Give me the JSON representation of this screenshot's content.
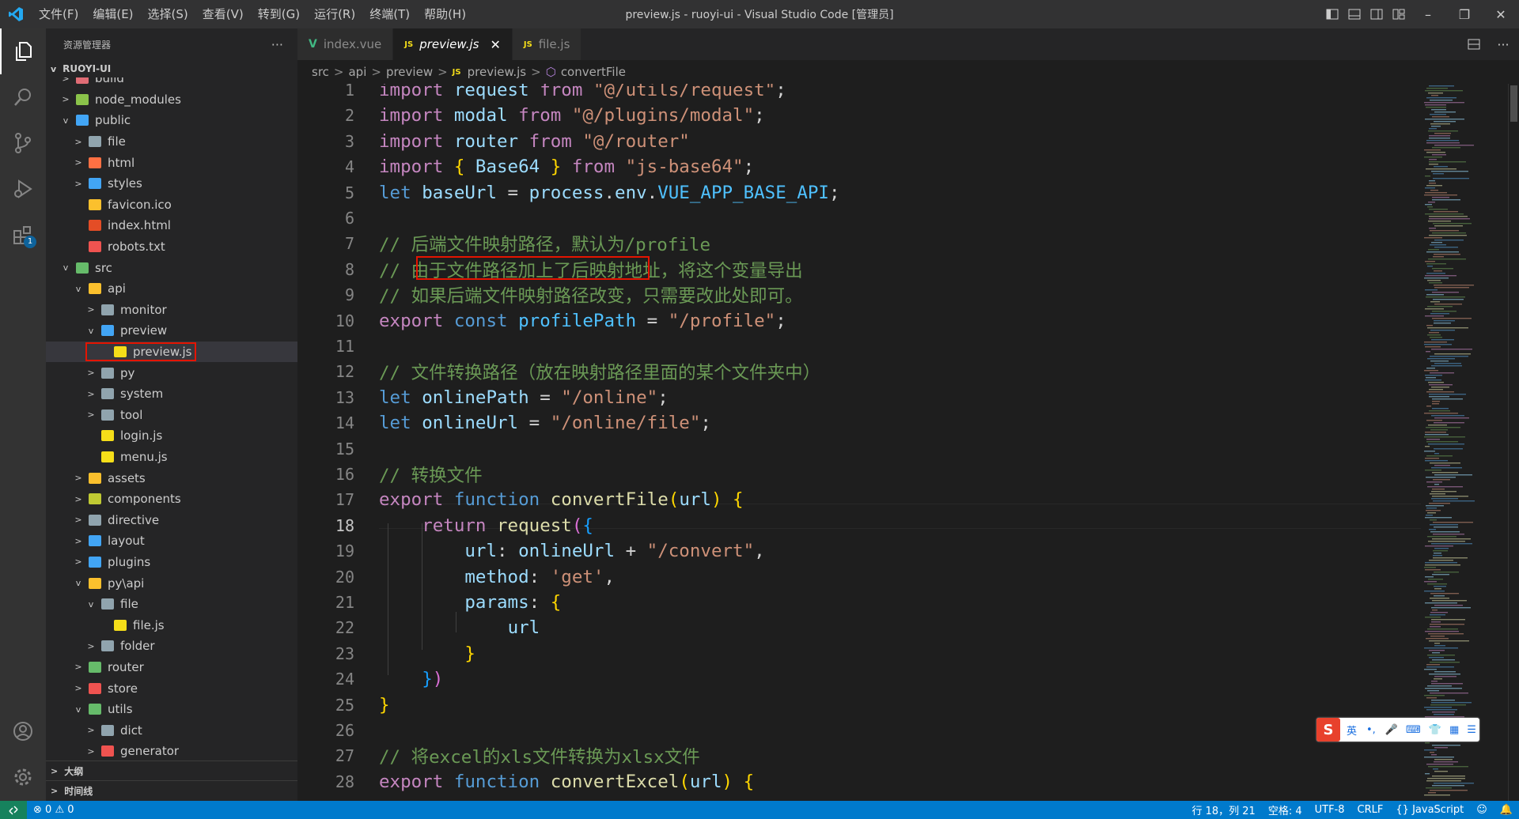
{
  "titlebar": {
    "menu": [
      "文件(F)",
      "编辑(E)",
      "选择(S)",
      "查看(V)",
      "转到(G)",
      "运行(R)",
      "终端(T)",
      "帮助(H)"
    ],
    "title": "preview.js - ruoyi-ui - Visual Studio Code [管理员]"
  },
  "activity": {
    "extensions_badge": "1"
  },
  "sidebar": {
    "header": "资源管理器",
    "more": "···",
    "root": "RUOYI-UI",
    "tree": [
      {
        "label": "build",
        "indent": 2,
        "chev": ">",
        "color": "#e06c75"
      },
      {
        "label": "node_modules",
        "indent": 2,
        "chev": ">",
        "color": "#8bc34a"
      },
      {
        "label": "public",
        "indent": 2,
        "chev": "v",
        "color": "#42a5f5"
      },
      {
        "label": "file",
        "indent": 3,
        "chev": ">",
        "color": "#90a4ae"
      },
      {
        "label": "html",
        "indent": 3,
        "chev": ">",
        "color": "#ff7043"
      },
      {
        "label": "styles",
        "indent": 3,
        "chev": ">",
        "color": "#42a5f5"
      },
      {
        "label": "favicon.ico",
        "indent": 3,
        "chev": "",
        "color": "#fbc02d"
      },
      {
        "label": "index.html",
        "indent": 3,
        "chev": "",
        "color": "#e44d26"
      },
      {
        "label": "robots.txt",
        "indent": 3,
        "chev": "",
        "color": "#ef5350"
      },
      {
        "label": "src",
        "indent": 2,
        "chev": "v",
        "color": "#66bb6a"
      },
      {
        "label": "api",
        "indent": 3,
        "chev": "v",
        "color": "#fbc02d"
      },
      {
        "label": "monitor",
        "indent": 4,
        "chev": ">",
        "color": "#90a4ae"
      },
      {
        "label": "preview",
        "indent": 4,
        "chev": "v",
        "color": "#42a5f5"
      },
      {
        "label": "preview.js",
        "indent": 5,
        "chev": "",
        "color": "#f5de19",
        "selected": true
      },
      {
        "label": "py",
        "indent": 4,
        "chev": ">",
        "color": "#90a4ae"
      },
      {
        "label": "system",
        "indent": 4,
        "chev": ">",
        "color": "#90a4ae"
      },
      {
        "label": "tool",
        "indent": 4,
        "chev": ">",
        "color": "#90a4ae"
      },
      {
        "label": "login.js",
        "indent": 4,
        "chev": "",
        "color": "#f5de19"
      },
      {
        "label": "menu.js",
        "indent": 4,
        "chev": "",
        "color": "#f5de19"
      },
      {
        "label": "assets",
        "indent": 3,
        "chev": ">",
        "color": "#fbc02d"
      },
      {
        "label": "components",
        "indent": 3,
        "chev": ">",
        "color": "#c0ca33"
      },
      {
        "label": "directive",
        "indent": 3,
        "chev": ">",
        "color": "#90a4ae"
      },
      {
        "label": "layout",
        "indent": 3,
        "chev": ">",
        "color": "#42a5f5"
      },
      {
        "label": "plugins",
        "indent": 3,
        "chev": ">",
        "color": "#42a5f5"
      },
      {
        "label": "py\\api",
        "indent": 3,
        "chev": "v",
        "color": "#fbc02d"
      },
      {
        "label": "file",
        "indent": 4,
        "chev": "v",
        "color": "#90a4ae"
      },
      {
        "label": "file.js",
        "indent": 5,
        "chev": "",
        "color": "#f5de19"
      },
      {
        "label": "folder",
        "indent": 4,
        "chev": ">",
        "color": "#90a4ae"
      },
      {
        "label": "router",
        "indent": 3,
        "chev": ">",
        "color": "#66bb6a"
      },
      {
        "label": "store",
        "indent": 3,
        "chev": ">",
        "color": "#ef5350"
      },
      {
        "label": "utils",
        "indent": 3,
        "chev": "v",
        "color": "#66bb6a"
      },
      {
        "label": "dict",
        "indent": 4,
        "chev": ">",
        "color": "#90a4ae"
      },
      {
        "label": "generator",
        "indent": 4,
        "chev": ">",
        "color": "#ef5350"
      }
    ],
    "outline": "大纲",
    "timeline": "时间线"
  },
  "tabs": [
    {
      "label": "index.vue",
      "icon": "V",
      "icon_color": "#41b883",
      "active": false
    },
    {
      "label": "preview.js",
      "icon": "JS",
      "icon_color": "#f5de19",
      "active": true
    },
    {
      "label": "file.js",
      "icon": "JS",
      "icon_color": "#f5de19",
      "active": false
    }
  ],
  "breadcrumb": [
    "src",
    "api",
    "preview",
    "preview.js",
    "convertFile"
  ],
  "code": {
    "current_line": 18,
    "lines": [
      {
        "n": "1",
        "tokens": [
          [
            "kc",
            "import"
          ],
          [
            "pu",
            " "
          ],
          [
            "vr",
            "request"
          ],
          [
            "pu",
            " "
          ],
          [
            "kc",
            "from"
          ],
          [
            "pu",
            " "
          ],
          [
            "st",
            "\"@/utils/request\""
          ],
          [
            "pu",
            ";"
          ]
        ]
      },
      {
        "n": "2",
        "tokens": [
          [
            "kc",
            "import"
          ],
          [
            "pu",
            " "
          ],
          [
            "vr",
            "modal"
          ],
          [
            "pu",
            " "
          ],
          [
            "kc",
            "from"
          ],
          [
            "pu",
            " "
          ],
          [
            "st",
            "\"@/plugins/modal\""
          ],
          [
            "pu",
            ";"
          ]
        ]
      },
      {
        "n": "3",
        "tokens": [
          [
            "kc",
            "import"
          ],
          [
            "pu",
            " "
          ],
          [
            "vr",
            "router"
          ],
          [
            "pu",
            " "
          ],
          [
            "kc",
            "from"
          ],
          [
            "pu",
            " "
          ],
          [
            "st",
            "\"@/router\""
          ]
        ]
      },
      {
        "n": "4",
        "tokens": [
          [
            "kc",
            "import"
          ],
          [
            "pu",
            " "
          ],
          [
            "br",
            "{"
          ],
          [
            "pu",
            " "
          ],
          [
            "vr",
            "Base64"
          ],
          [
            "pu",
            " "
          ],
          [
            "br",
            "}"
          ],
          [
            "pu",
            " "
          ],
          [
            "kc",
            "from"
          ],
          [
            "pu",
            " "
          ],
          [
            "st",
            "\"js-base64\""
          ],
          [
            "pu",
            ";"
          ]
        ]
      },
      {
        "n": "5",
        "tokens": [
          [
            "kw",
            "let"
          ],
          [
            "pu",
            " "
          ],
          [
            "vr",
            "baseUrl"
          ],
          [
            "pu",
            " = "
          ],
          [
            "vr",
            "process"
          ],
          [
            "pu",
            "."
          ],
          [
            "vr",
            "env"
          ],
          [
            "pu",
            "."
          ],
          [
            "cv",
            "VUE_APP_BASE_API"
          ],
          [
            "pu",
            ";"
          ]
        ]
      },
      {
        "n": "6",
        "tokens": []
      },
      {
        "n": "7",
        "tokens": [
          [
            "cm",
            "// 后端文件映射路径，默认为/profile"
          ]
        ]
      },
      {
        "n": "8",
        "tokens": [
          [
            "cm",
            "// 由于文件路径加上了后映射地址，将这个变量导出"
          ]
        ]
      },
      {
        "n": "9",
        "tokens": [
          [
            "cm",
            "// 如果后端文件映射路径改变，只需要改此处即可。"
          ]
        ]
      },
      {
        "n": "10",
        "tokens": [
          [
            "kc",
            "export"
          ],
          [
            "pu",
            " "
          ],
          [
            "kw",
            "const"
          ],
          [
            "pu",
            " "
          ],
          [
            "cv",
            "profilePath"
          ],
          [
            "pu",
            " = "
          ],
          [
            "st",
            "\"/profile\""
          ],
          [
            "pu",
            ";"
          ]
        ]
      },
      {
        "n": "11",
        "tokens": []
      },
      {
        "n": "12",
        "tokens": [
          [
            "cm",
            "// 文件转换路径（放在映射路径里面的某个文件夹中）"
          ]
        ]
      },
      {
        "n": "13",
        "tokens": [
          [
            "kw",
            "let"
          ],
          [
            "pu",
            " "
          ],
          [
            "vr",
            "onlinePath"
          ],
          [
            "pu",
            " = "
          ],
          [
            "st",
            "\"/online\""
          ],
          [
            "pu",
            ";"
          ]
        ]
      },
      {
        "n": "14",
        "tokens": [
          [
            "kw",
            "let"
          ],
          [
            "pu",
            " "
          ],
          [
            "vr",
            "onlineUrl"
          ],
          [
            "pu",
            " = "
          ],
          [
            "st",
            "\"/online/file\""
          ],
          [
            "pu",
            ";"
          ]
        ]
      },
      {
        "n": "15",
        "tokens": []
      },
      {
        "n": "16",
        "tokens": [
          [
            "cm",
            "// 转换文件"
          ]
        ]
      },
      {
        "n": "17",
        "tokens": [
          [
            "kc",
            "export"
          ],
          [
            "pu",
            " "
          ],
          [
            "kw",
            "function"
          ],
          [
            "pu",
            " "
          ],
          [
            "fn",
            "convertFile"
          ],
          [
            "br",
            "("
          ],
          [
            "vr",
            "url"
          ],
          [
            "br",
            ")"
          ],
          [
            "pu",
            " "
          ],
          [
            "br",
            "{"
          ]
        ]
      },
      {
        "n": "18",
        "tokens": [
          [
            "pu",
            "    "
          ],
          [
            "kc",
            "return"
          ],
          [
            "pu",
            " "
          ],
          [
            "fn",
            "request"
          ],
          [
            "br2",
            "("
          ],
          [
            "br3",
            "{"
          ]
        ]
      },
      {
        "n": "19",
        "tokens": [
          [
            "pu",
            "        "
          ],
          [
            "vr",
            "url"
          ],
          [
            "pu",
            ": "
          ],
          [
            "vr",
            "onlineUrl"
          ],
          [
            "pu",
            " + "
          ],
          [
            "st",
            "\"/convert\""
          ],
          [
            "pu",
            ","
          ]
        ]
      },
      {
        "n": "20",
        "tokens": [
          [
            "pu",
            "        "
          ],
          [
            "vr",
            "method"
          ],
          [
            "pu",
            ": "
          ],
          [
            "st",
            "'get'"
          ],
          [
            "pu",
            ","
          ]
        ]
      },
      {
        "n": "21",
        "tokens": [
          [
            "pu",
            "        "
          ],
          [
            "vr",
            "params"
          ],
          [
            "pu",
            ": "
          ],
          [
            "br",
            "{"
          ]
        ]
      },
      {
        "n": "22",
        "tokens": [
          [
            "pu",
            "            "
          ],
          [
            "vr",
            "url"
          ]
        ]
      },
      {
        "n": "23",
        "tokens": [
          [
            "pu",
            "        "
          ],
          [
            "br",
            "}"
          ]
        ]
      },
      {
        "n": "24",
        "tokens": [
          [
            "pu",
            "    "
          ],
          [
            "br3",
            "}"
          ],
          [
            "br2",
            ")"
          ]
        ]
      },
      {
        "n": "25",
        "tokens": [
          [
            "br",
            "}"
          ]
        ]
      },
      {
        "n": "26",
        "tokens": []
      },
      {
        "n": "27",
        "tokens": [
          [
            "cm",
            "// 将excel的xls文件转换为xlsx文件"
          ]
        ]
      },
      {
        "n": "28",
        "tokens": [
          [
            "kc",
            "export"
          ],
          [
            "pu",
            " "
          ],
          [
            "kw",
            "function"
          ],
          [
            "pu",
            " "
          ],
          [
            "fn",
            "convertExcel"
          ],
          [
            "br",
            "("
          ],
          [
            "vr",
            "url"
          ],
          [
            "br",
            ")"
          ],
          [
            "pu",
            " "
          ],
          [
            "br",
            "{"
          ]
        ]
      }
    ]
  },
  "status": {
    "errors": "0",
    "warnings": "0",
    "position": "行 18，列 21",
    "indent": "空格: 4",
    "encoding": "UTF-8",
    "eol": "CRLF",
    "language": "JavaScript"
  },
  "ime": {
    "lang": "英"
  }
}
